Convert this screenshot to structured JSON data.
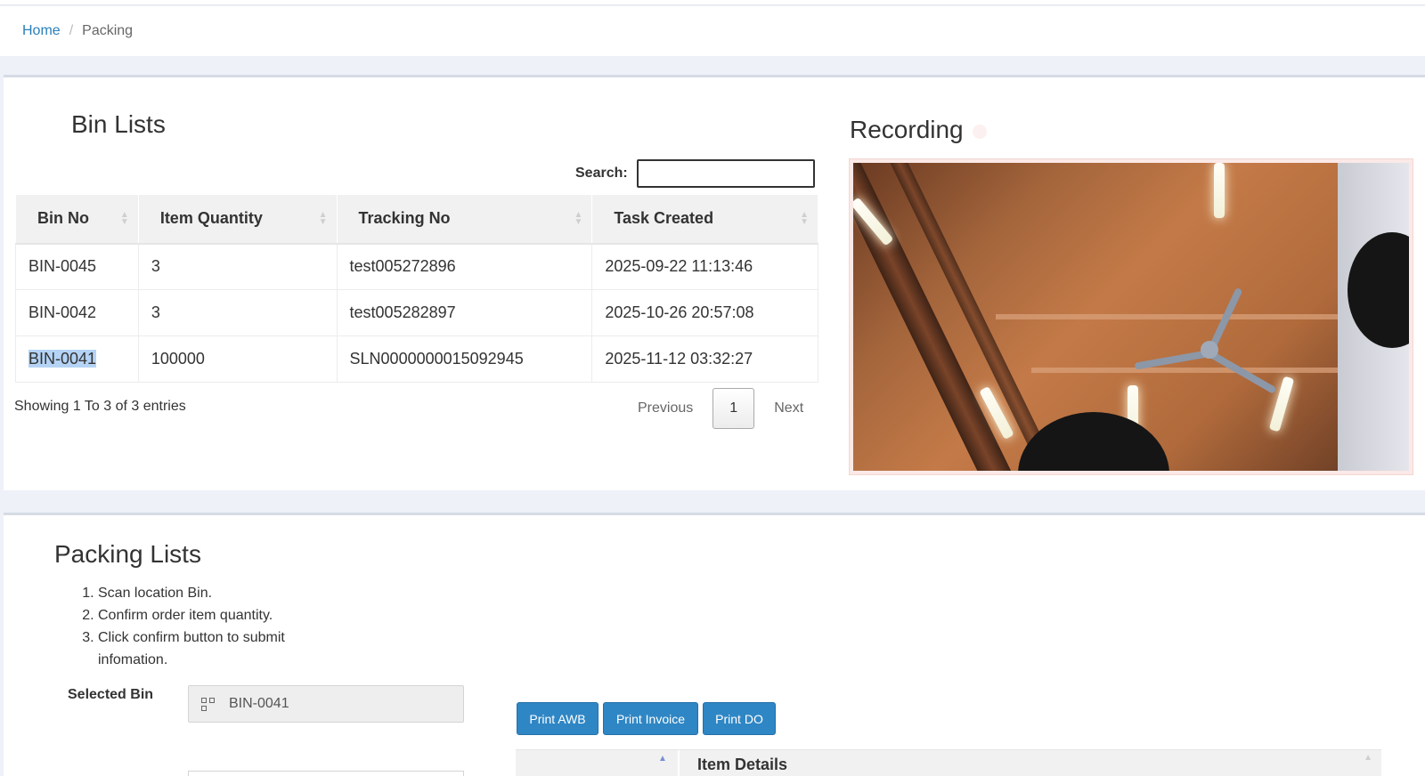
{
  "breadcrumb": {
    "home": "Home",
    "separator": "/",
    "current": "Packing"
  },
  "bin_lists": {
    "title": "Bin Lists",
    "search_label": "Search:",
    "search_value": "",
    "columns": [
      "Bin No",
      "Item Quantity",
      "Tracking No",
      "Task Created"
    ],
    "rows": [
      {
        "bin_no": "BIN-0045",
        "qty": "3",
        "tracking": "test005272896",
        "created": "2025-09-22 11:13:46"
      },
      {
        "bin_no": "BIN-0042",
        "qty": "3",
        "tracking": "test005282897",
        "created": "2025-10-26 20:57:08"
      },
      {
        "bin_no": "BIN-0041",
        "qty": "100000",
        "tracking": "SLN0000000015092945",
        "created": "2025-11-12 03:32:27"
      }
    ],
    "showing": "Showing 1 To 3 of 3 entries",
    "pager": {
      "previous": "Previous",
      "page": "1",
      "next": "Next"
    }
  },
  "recording": {
    "title": "Recording"
  },
  "packing_lists": {
    "title": "Packing Lists",
    "steps": [
      "Scan location Bin.",
      "Confirm order item quantity.",
      "Click confirm button to submit infomation."
    ],
    "selected_bin_label": "Selected Bin",
    "selected_bin_value": "BIN-0041",
    "buttons": {
      "print_awb": "Print AWB",
      "print_invoice": "Print Invoice",
      "print_do": "Print DO"
    },
    "item_details_header": "Item Details"
  },
  "colors": {
    "accent": "#2f86c4",
    "link": "#2a7fb8",
    "highlight": "#b4d3f5"
  }
}
